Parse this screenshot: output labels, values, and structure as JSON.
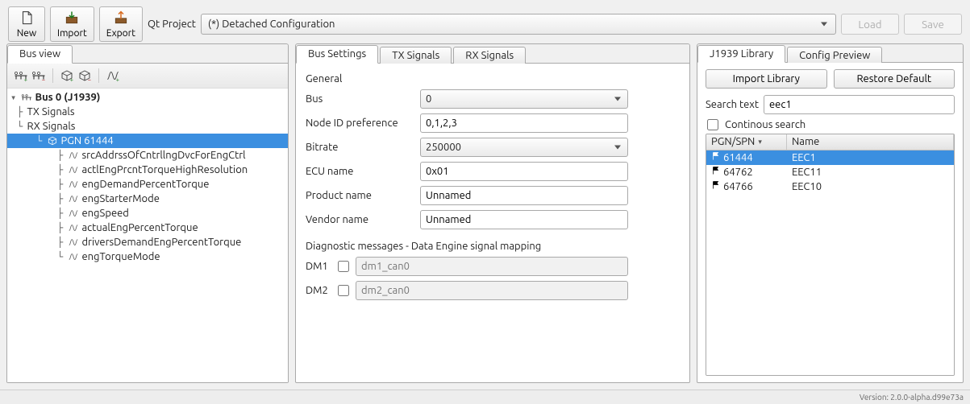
{
  "toolbar": {
    "new": "New",
    "import": "Import",
    "export": "Export",
    "qt_label": "Qt Project",
    "config": "(*) Detached Configuration",
    "load": "Load",
    "save": "Save"
  },
  "left": {
    "tab": "Bus view",
    "tree": {
      "root": "Bus 0 (J1939)",
      "tx": "TX Signals",
      "rx": "RX Signals",
      "pgn": "PGN 61444",
      "sig": [
        "srcAddrssOfCntrllngDvcForEngCtrl",
        "actlEngPrcntTorqueHighResolution",
        "engDemandPercentTorque",
        "engStarterMode",
        "engSpeed",
        "actualEngPercentTorque",
        "driversDemandEngPercentTorque",
        "engTorqueMode"
      ]
    }
  },
  "mid": {
    "tabs": {
      "settings": "Bus Settings",
      "tx": "TX Signals",
      "rx": "RX Signals"
    },
    "section_general": "General",
    "fields": {
      "bus_l": "Bus",
      "bus_v": "0",
      "node_l": "Node ID preference",
      "node_v": "0,1,2,3",
      "bitrate_l": "Bitrate",
      "bitrate_v": "250000",
      "ecu_l": "ECU name",
      "ecu_v": "0x01",
      "prod_l": "Product name",
      "prod_v": "Unnamed",
      "vendor_l": "Vendor name",
      "vendor_v": "Unnamed"
    },
    "section_diag": "Diagnostic messages - Data Engine signal mapping",
    "diag": {
      "dm1_l": "DM1",
      "dm1_ph": "dm1_can0",
      "dm2_l": "DM2",
      "dm2_ph": "dm2_can0"
    }
  },
  "right": {
    "tabs": {
      "lib": "J1939 Library",
      "cfg": "Config Preview"
    },
    "btn_import": "Import Library",
    "btn_restore": "Restore Default",
    "search_l": "Search text",
    "search_v": "eec1",
    "cont_l": "Continous search",
    "cols": {
      "c1": "PGN/SPN",
      "c2": "Name"
    },
    "rows": [
      {
        "pgn": "61444",
        "name": "EEC1"
      },
      {
        "pgn": "64762",
        "name": "EEC11"
      },
      {
        "pgn": "64766",
        "name": "EEC10"
      }
    ]
  },
  "status": "Version: 2.0.0-alpha.d99e73a"
}
